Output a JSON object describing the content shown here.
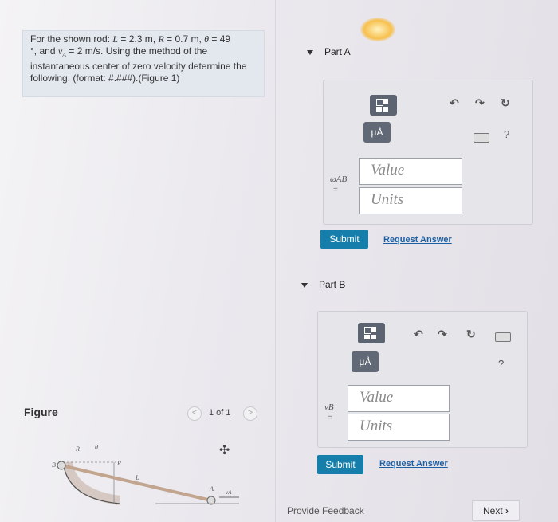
{
  "problem": {
    "line1_prefix": "For the shown rod: ",
    "L_sym": "L",
    "L_val": " = 2.3 m, ",
    "R_sym": "R",
    "R_val": " = 0.7 m, ",
    "theta_sym": "θ",
    "theta_val": " = 49",
    "line2": "°, and ",
    "vA_sym": "v",
    "vA_sub": "A",
    "vA_val": " = 2 m/s.",
    "line2_rest": " Using the method of the",
    "line3": "instantaneous center of zero velocity determine the",
    "line4": "following. (format: #.###).",
    "figure_link": "(Figure 1)"
  },
  "figure": {
    "label": "Figure",
    "pager_text": "1 of 1",
    "prev_glyph": "<",
    "next_glyph": ">",
    "labels": {
      "R_top": "R",
      "theta": "θ",
      "B": "B",
      "R_side": "R",
      "L": "L",
      "A": "A",
      "vA": "vA"
    }
  },
  "partA": {
    "title": "Part A",
    "mu_label": "μÅ",
    "var_label": "ωAB",
    "eq": "=",
    "value_placeholder": "Value",
    "units_placeholder": "Units",
    "submit": "Submit",
    "request": "Request Answer",
    "help": "?"
  },
  "partB": {
    "title": "Part B",
    "mu_label": "μÅ",
    "var_label": "vB",
    "eq": "=",
    "value_placeholder": "Value",
    "units_placeholder": "Units",
    "submit": "Submit",
    "request": "Request Answer",
    "help": "?"
  },
  "footer": {
    "feedback": "Provide Feedback",
    "next": "Next",
    "next_glyph": "›"
  },
  "colors": {
    "submit_bg": "#157eaa",
    "link": "#1d5fa3",
    "panel_bg": "#e6e5ea"
  }
}
